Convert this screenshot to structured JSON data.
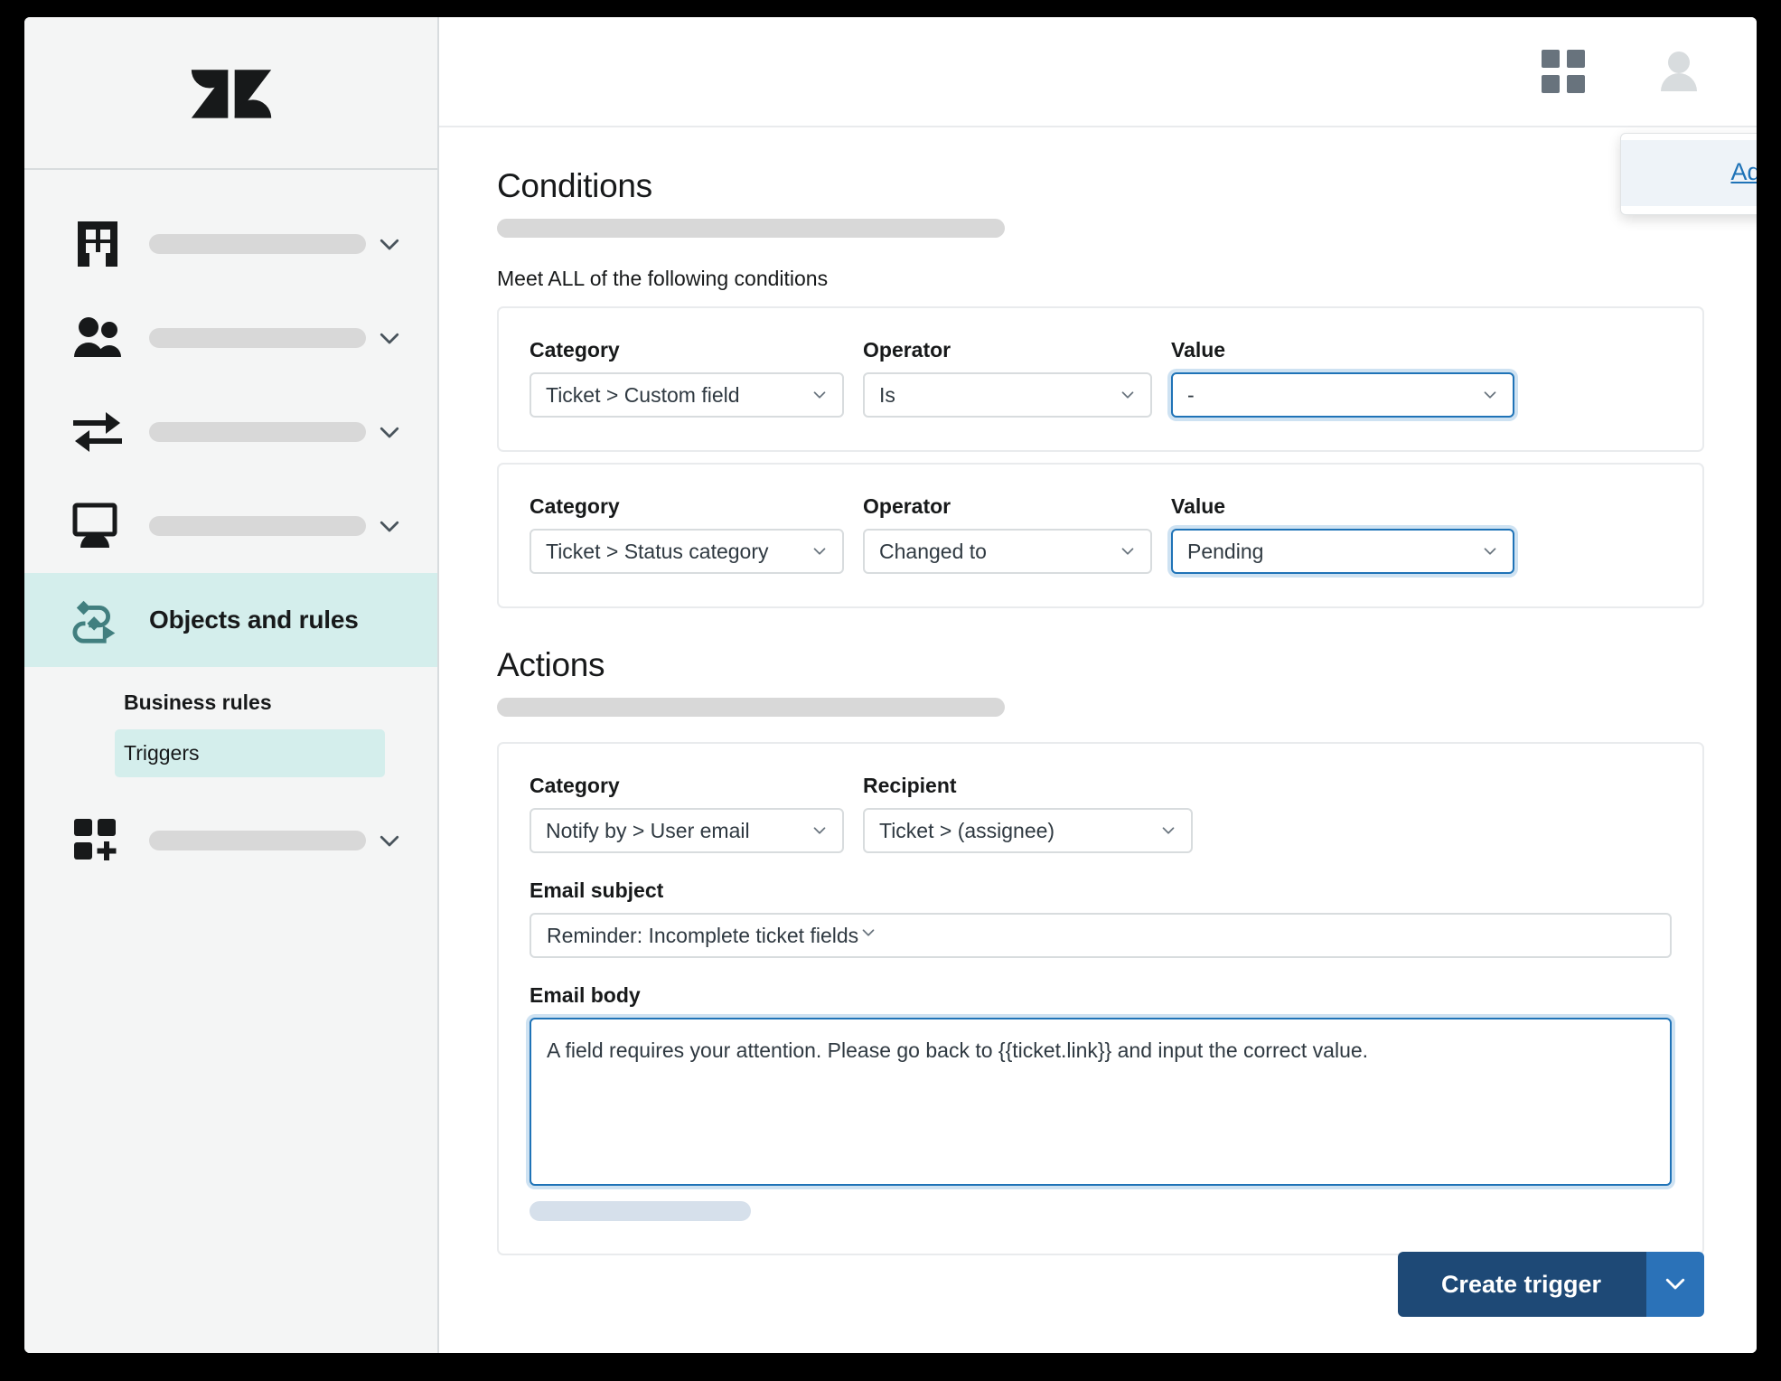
{
  "app": {
    "logo_name": "zendesk-logo"
  },
  "header": {
    "grid_icon": "grid-apps-icon",
    "avatar_icon": "user-avatar-icon",
    "popover": {
      "link_label": "Admin Center"
    }
  },
  "sidebar": {
    "items": [
      {
        "icon": "building-icon",
        "label": "",
        "skeleton": true,
        "active": false
      },
      {
        "icon": "people-icon",
        "label": "",
        "skeleton": true,
        "active": false
      },
      {
        "icon": "arrows-exchange-icon",
        "label": "",
        "skeleton": true,
        "active": false
      },
      {
        "icon": "monitor-icon",
        "label": "",
        "skeleton": true,
        "active": false
      },
      {
        "icon": "objects-rules-icon",
        "label": "Objects and rules",
        "skeleton": false,
        "active": true
      },
      {
        "icon": "apps-add-icon",
        "label": "",
        "skeleton": true,
        "active": false
      }
    ],
    "subnav": {
      "group_label": "Business rules",
      "selected_item": "Triggers"
    }
  },
  "main": {
    "conditions": {
      "title": "Conditions",
      "subtitle": "Meet ALL of the following conditions",
      "rows": [
        {
          "category_label": "Category",
          "category_value": "Ticket > Custom field",
          "operator_label": "Operator",
          "operator_value": "Is",
          "value_label": "Value",
          "value_value": "-",
          "value_focused": true
        },
        {
          "category_label": "Category",
          "category_value": "Ticket > Status category",
          "operator_label": "Operator",
          "operator_value": "Changed to",
          "value_label": "Value",
          "value_value": "Pending",
          "value_focused": true
        }
      ]
    },
    "actions": {
      "title": "Actions",
      "category_label": "Category",
      "category_value": "Notify by > User email",
      "recipient_label": "Recipient",
      "recipient_value": "Ticket > (assignee)",
      "email_subject_label": "Email subject",
      "email_subject_value": "Reminder: Incomplete ticket fields",
      "email_body_label": "Email body",
      "email_body_value": "A field requires your attention. Please go back to {{ticket.link}} and input the correct value."
    },
    "footer": {
      "primary_label": "Create trigger",
      "caret_icon": "chevron-down-icon"
    }
  },
  "colors": {
    "accent_teal": "#d4eeec",
    "link_blue": "#1f73b7",
    "focus_blue": "#1f73b7",
    "primary_button": "#1e4976",
    "caret_button": "#2b72b8"
  }
}
